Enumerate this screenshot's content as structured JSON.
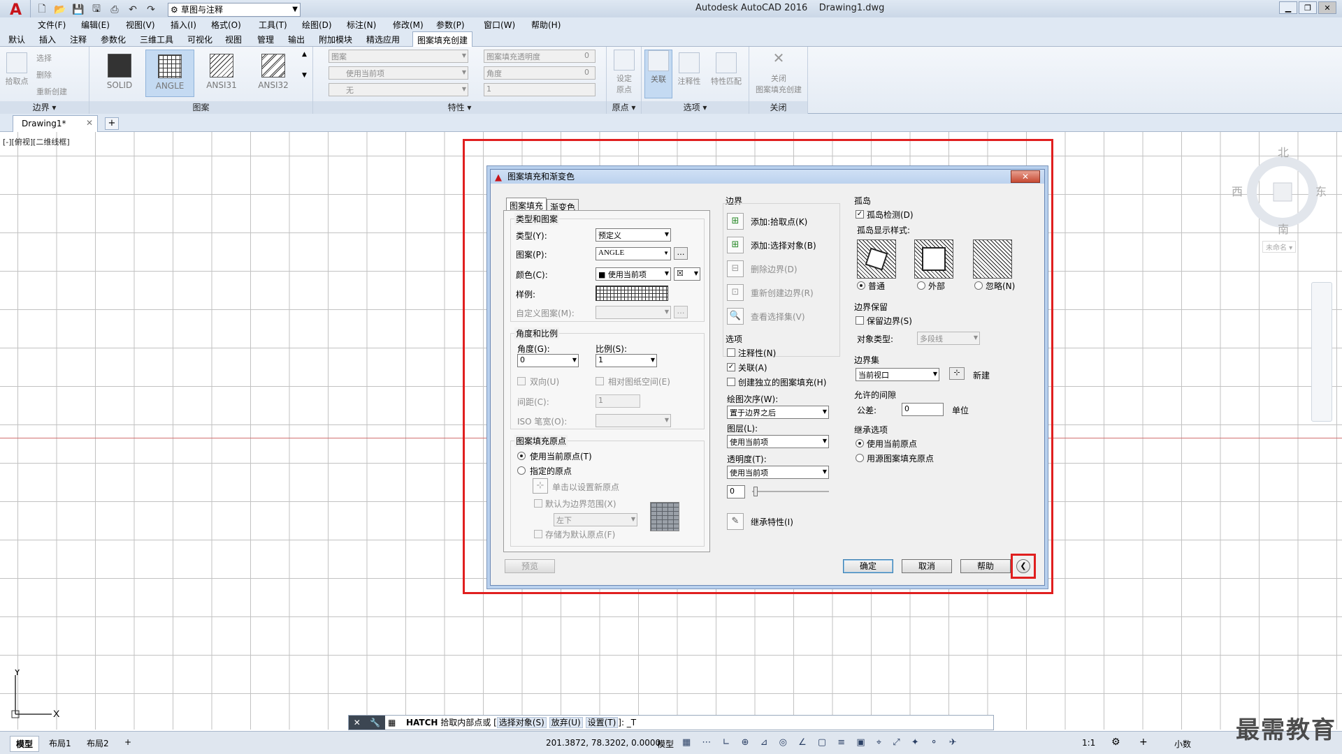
{
  "app": {
    "title": "Autodesk AutoCAD 2016",
    "file": "Drawing1.dwg",
    "workspace": "草图与注释",
    "logo": "A"
  },
  "menu": [
    "文件(F)",
    "编辑(E)",
    "视图(V)",
    "插入(I)",
    "格式(O)",
    "工具(T)",
    "绘图(D)",
    "标注(N)",
    "修改(M)",
    "参数(P)",
    "窗口(W)",
    "帮助(H)"
  ],
  "ribbon_tabs": [
    "默认",
    "插入",
    "注释",
    "参数化",
    "三维工具",
    "可视化",
    "视图",
    "管理",
    "输出",
    "附加模块",
    "精选应用",
    "图案填充创建"
  ],
  "ribbon": {
    "boundary": {
      "pick": "拾取点",
      "select": "选择",
      "remove": "删除",
      "recreate": "重新创建",
      "label": "边界 ▾"
    },
    "patterns": [
      "SOLID",
      "ANGLE",
      "ANSI31",
      "ANSI32"
    ],
    "pattern_label": "图案",
    "props": {
      "type": "图案",
      "color": "使用当前项",
      "bg": "无",
      "transparency": "图案填充透明度",
      "trans_val": "0",
      "angle": "角度",
      "angle_val": "0",
      "scale": "1",
      "label": "特性 ▾"
    },
    "origin": {
      "set": "设定\n原点",
      "label": "原点 ▾"
    },
    "options": {
      "assoc": "关联",
      "annot": "注释性",
      "match": "特性匹配",
      "label": "选项 ▾"
    },
    "close": {
      "btn": "关闭\n图案填充创建",
      "label": "关闭"
    }
  },
  "drawing_tab": "Drawing1*",
  "view_label": "[-][俯视][二维线框]",
  "viewcube": {
    "n": "北",
    "s": "南",
    "e": "东",
    "w": "西",
    "ucs": "未命名 ▾"
  },
  "dialog": {
    "title": "图案填充和渐变色",
    "tabs": [
      "图案填充",
      "渐变色"
    ],
    "type_pattern": {
      "group": "类型和图案",
      "type_label": "类型(Y):",
      "type_value": "预定义",
      "pattern_label": "图案(P):",
      "pattern_value": "ANGLE",
      "color_label": "颜色(C):",
      "color_value": "■ 使用当前项",
      "color2": "☒",
      "sample_label": "样例:",
      "custom_label": "自定义图案(M):"
    },
    "angle_scale": {
      "group": "角度和比例",
      "angle_label": "角度(G):",
      "angle_value": "0",
      "scale_label": "比例(S):",
      "scale_value": "1",
      "double_label": "双向(U)",
      "relative_label": "相对图纸空间(E)",
      "spacing_label": "间距(C):",
      "spacing_value": "1",
      "iso_label": "ISO 笔宽(O):"
    },
    "origin": {
      "group": "图案填充原点",
      "use_current": "使用当前原点(T)",
      "specified": "指定的原点",
      "click_set": "单击以设置新原点",
      "default_extent": "默认为边界范围(X)",
      "position": "左下",
      "store": "存储为默认原点(F)"
    },
    "boundary": {
      "title": "边界",
      "add_pick": "添加:拾取点(K)",
      "add_select": "添加:选择对象(B)",
      "remove": "删除边界(D)",
      "recreate": "重新创建边界(R)",
      "view": "查看选择集(V)"
    },
    "options": {
      "title": "选项",
      "annotative": "注释性(N)",
      "associative": "关联(A)",
      "separate": "创建独立的图案填充(H)",
      "draw_order_label": "绘图次序(W):",
      "draw_order": "置于边界之后",
      "layer_label": "图层(L):",
      "layer": "使用当前项",
      "transparency_label": "透明度(T):",
      "transparency": "使用当前项",
      "trans_value": "0"
    },
    "inherit": "继承特性(I)",
    "islands": {
      "title": "孤岛",
      "detect": "孤岛检测(D)",
      "style_label": "孤岛显示样式:",
      "normal": "普通",
      "outer": "外部",
      "ignore": "忽略(N)"
    },
    "retain": {
      "title": "边界保留",
      "keep": "保留边界(S)",
      "obj_type_label": "对象类型:",
      "obj_type": "多段线"
    },
    "boundary_set": {
      "title": "边界集",
      "value": "当前视口",
      "new": "新建"
    },
    "gap": {
      "title": "允许的间隙",
      "tol_label": "公差:",
      "tol_value": "0",
      "unit": "单位"
    },
    "inherit_opts": {
      "title": "继承选项",
      "current": "使用当前原点",
      "source": "用源图案填充原点"
    },
    "buttons": {
      "preview": "预览",
      "ok": "确定",
      "cancel": "取消",
      "help": "帮助",
      "collapse": "❮"
    }
  },
  "command": {
    "prompt_cmd": "HATCH",
    "prompt": "拾取内部点或 [",
    "opt1": "选择对象(S)",
    "opt2": "放弃(U)",
    "opt3": "设置(T)",
    "tail": "]: _T"
  },
  "status": {
    "layout_tabs": [
      "模型",
      "布局1",
      "布局2"
    ],
    "coords": "201.3872, 78.3202, 0.0000",
    "model": "模型",
    "scale": "1:1",
    "units": "小数"
  },
  "watermark": "最需教育"
}
